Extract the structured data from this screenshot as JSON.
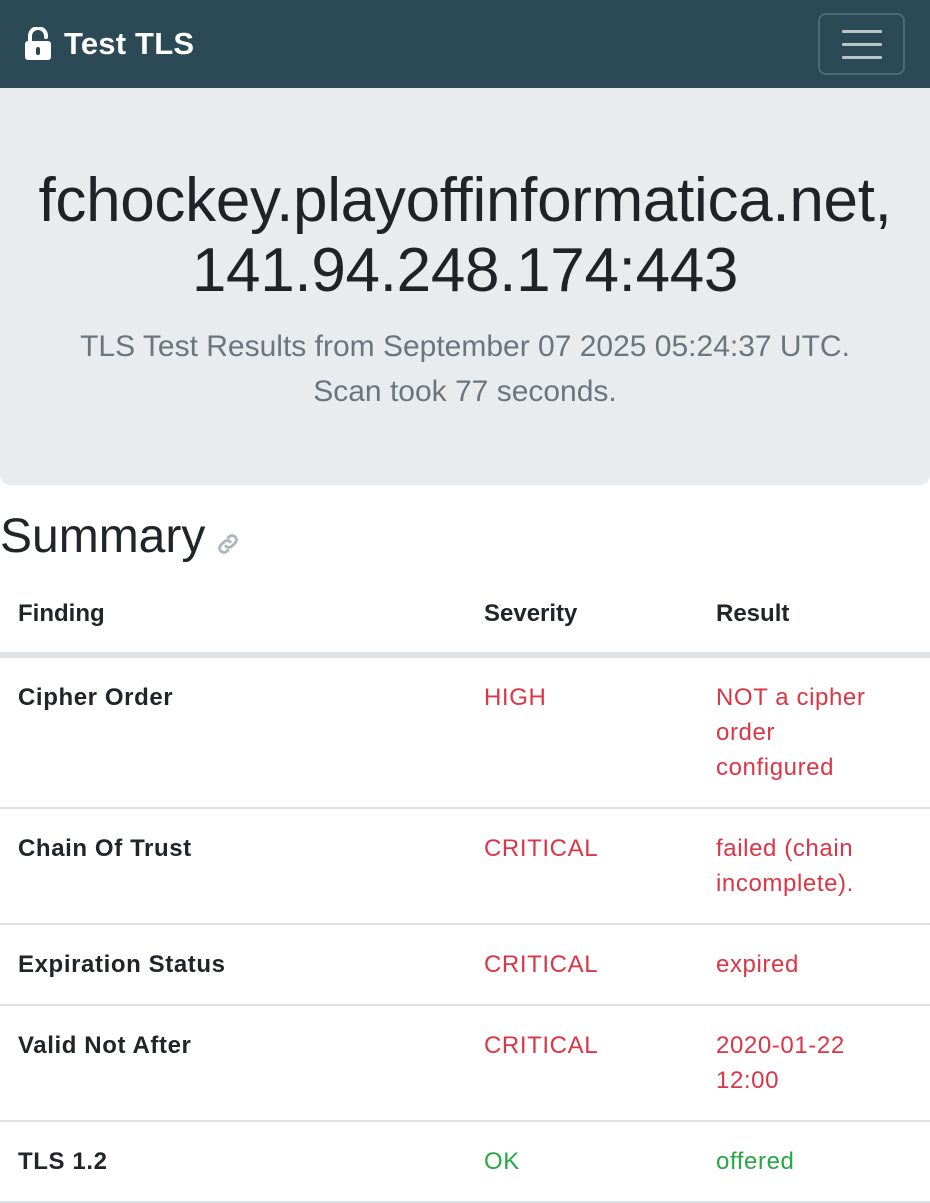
{
  "navbar": {
    "brand_text": "Test TLS",
    "brand_icon": "lock-open-icon",
    "menu_icon": "hamburger-menu-icon",
    "background_color": "#2b4a56"
  },
  "hero": {
    "title_line1": "fchockey.playoffinformatica.net,",
    "title_line2": "141.94.248.174:443",
    "lead_line1": "TLS Test Results from September 07 2025 05:24:37 UTC.",
    "lead_line2": "Scan took 77 seconds."
  },
  "summary": {
    "title": "Summary",
    "anchor_icon": "link-icon",
    "columns": [
      "Finding",
      "Severity",
      "Result"
    ],
    "rows": [
      {
        "finding": "Cipher Order",
        "severity": "HIGH",
        "result": "NOT a cipher order configured"
      },
      {
        "finding": "Chain Of Trust",
        "severity": "CRITICAL",
        "result": "failed (chain incomplete)."
      },
      {
        "finding": "Expiration Status",
        "severity": "CRITICAL",
        "result": "expired"
      },
      {
        "finding": "Valid Not After",
        "severity": "CRITICAL",
        "result": "2020-01-22 12:00"
      },
      {
        "finding": "TLS 1.2",
        "severity": "OK",
        "result": "offered"
      }
    ]
  },
  "colors": {
    "danger": "#dc3545",
    "success": "#28a745",
    "muted": "#6c757d",
    "hero_background": "#e9ecef"
  }
}
